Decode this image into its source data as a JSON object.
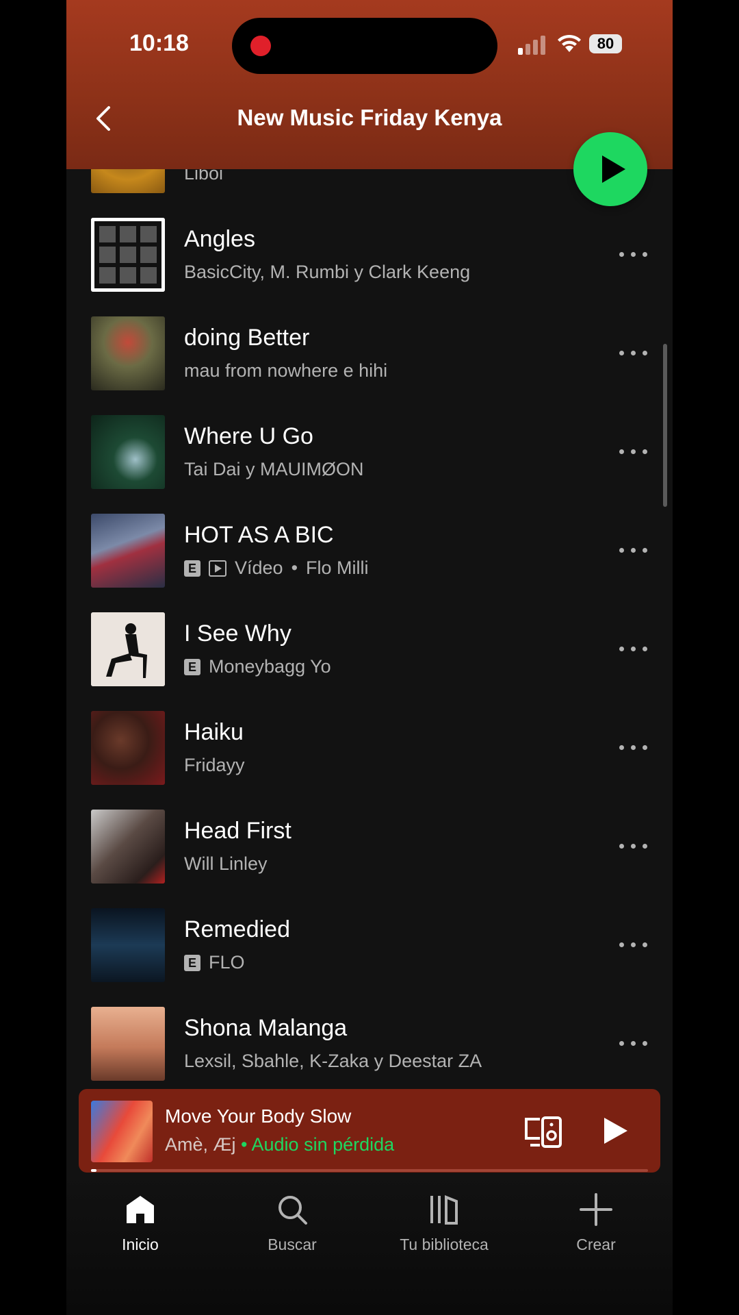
{
  "status_bar": {
    "time": "10:18",
    "battery": "80"
  },
  "header": {
    "title": "New Music Friday Kenya"
  },
  "tracks": [
    {
      "title": "",
      "artist": "Liboi",
      "explicit": false,
      "video": false
    },
    {
      "title": "Angles",
      "artist": "BasicCity, M. Rumbi y Clark Keeng",
      "explicit": false,
      "video": false
    },
    {
      "title": "doing Better",
      "artist": "mau from nowhere e hihi",
      "explicit": false,
      "video": false
    },
    {
      "title": "Where U Go",
      "artist": "Tai Dai y MAUIMØON",
      "explicit": false,
      "video": false
    },
    {
      "title": "HOT AS A BIC",
      "artist": "Flo Milli",
      "explicit": true,
      "video": true,
      "video_label": "Vídeo",
      "separator": "•"
    },
    {
      "title": "I See Why",
      "artist": "Moneybagg Yo",
      "explicit": true,
      "video": false
    },
    {
      "title": "Haiku",
      "artist": "Fridayy",
      "explicit": false,
      "video": false
    },
    {
      "title": "Head First",
      "artist": "Will Linley",
      "explicit": false,
      "video": false
    },
    {
      "title": "Remedied",
      "artist": "FLO",
      "explicit": true,
      "video": false
    },
    {
      "title": "Shona Malanga",
      "artist": "Lexsil, Sbahle, K-Zaka y Deestar ZA",
      "explicit": false,
      "video": false
    }
  ],
  "explicit_badge": "E",
  "now_playing": {
    "title": "Move Your Body Slow",
    "artists": "Amè, Æj",
    "quality": "• Audio sin pérdida",
    "progress": 0.01
  },
  "nav": [
    {
      "label": "Inicio",
      "icon": "home-icon",
      "active": true
    },
    {
      "label": "Buscar",
      "icon": "search-icon",
      "active": false
    },
    {
      "label": "Tu biblioteca",
      "icon": "library-icon",
      "active": false
    },
    {
      "label": "Crear",
      "icon": "plus-icon",
      "active": false
    }
  ],
  "colors": {
    "accent": "#1ed760",
    "header": "#a53a1f",
    "mini_player": "#7b2112",
    "background": "#121212"
  }
}
